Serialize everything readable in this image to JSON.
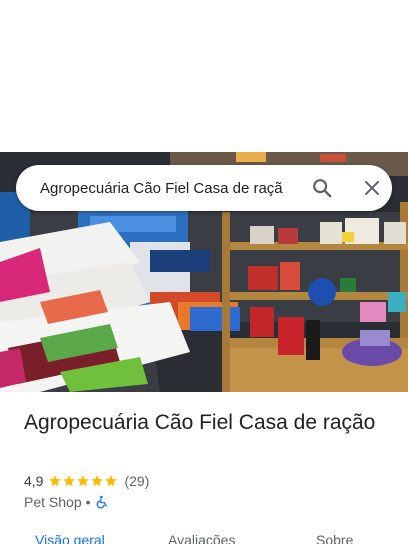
{
  "search": {
    "query": "Agropecuária Cão Fiel Casa de raçã"
  },
  "place": {
    "name": "Agropecuária Cão Fiel Casa de ração",
    "rating": "4,9",
    "star_count": 5,
    "reviews": "(29)",
    "category": "Pet Shop",
    "separator": "•",
    "accessibility_icon": "wheelchair-icon",
    "star_color": "#fbbc04",
    "accent_color": "#1a73e8"
  },
  "tabs": [
    {
      "label": "Visão geral",
      "active": true
    },
    {
      "label": "Avaliações",
      "active": false
    },
    {
      "label": "Sobre",
      "active": false
    }
  ]
}
